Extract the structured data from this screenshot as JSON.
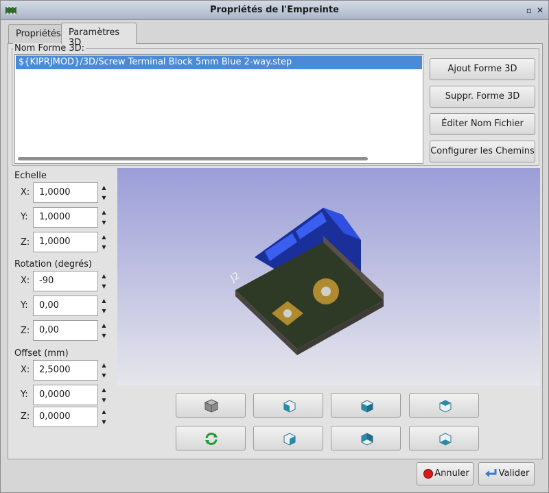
{
  "window": {
    "title": "Propriétés de l'Empreinte"
  },
  "tabs": [
    {
      "label": "Propriétés"
    },
    {
      "label": "Paramètres 3D"
    }
  ],
  "shape_group": {
    "legend": "Nom Forme 3D:",
    "items": [
      "${KIPRJMOD}/3D/Screw Terminal Block 5mm Blue 2-way.step"
    ]
  },
  "shape_buttons": {
    "add": "Ajout Forme 3D",
    "remove": "Suppr. Forme 3D",
    "edit": "Éditer Nom Fichier",
    "config": "Configurer les Chemins"
  },
  "scale": {
    "label": "Echelle",
    "x": "1,0000",
    "y": "1,0000",
    "z": "1,0000"
  },
  "rotation": {
    "label": "Rotation (degrés)",
    "x": "-90",
    "y": "0,00",
    "z": "0,00"
  },
  "offset": {
    "label": "Offset (mm)",
    "x": "2,5000",
    "y": "0,0000",
    "z": "0,0000"
  },
  "axis": {
    "x": "X:",
    "y": "Y:",
    "z": "Z:"
  },
  "preview": {
    "silkscreen_text": "J2"
  },
  "view_buttons": [
    "view-3d-cube-icon",
    "view-left-icon",
    "view-front-icon",
    "view-top-icon",
    "reload-icon",
    "view-right-icon",
    "view-back-icon",
    "view-bottom-icon"
  ],
  "footer": {
    "cancel": "Annuler",
    "ok": "Valider"
  },
  "colors": {
    "selection": "#4a8ad6",
    "view_bg_top": "#9b9dd8",
    "view_bg_bottom": "#e6e6ec",
    "board": "#2e3a26",
    "connector": "#1a2f9a"
  }
}
